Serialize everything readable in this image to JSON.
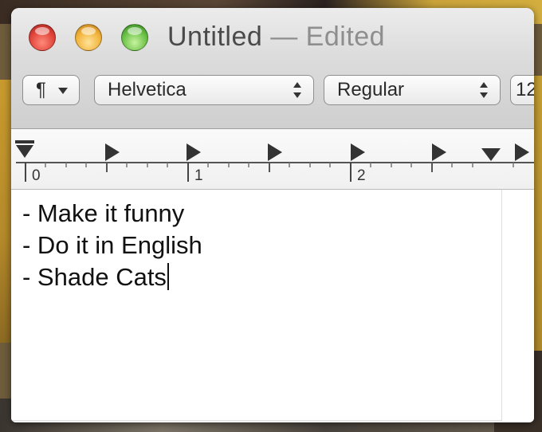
{
  "window": {
    "title": "Untitled",
    "edited_suffix": "— Edited"
  },
  "toolbar": {
    "paragraph_glyph": "¶",
    "font_family_value": "Helvetica",
    "font_style_value": "Regular",
    "font_size_value": "12"
  },
  "ruler": {
    "labels": [
      "0",
      "1",
      "2"
    ]
  },
  "document": {
    "lines": [
      "- Make it funny",
      "- Do it in English",
      "- Shade Cats"
    ]
  },
  "icons": {
    "close": "close-button-icon",
    "minimize": "minimize-button-icon",
    "zoom": "zoom-button-icon",
    "paragraph": "paragraph-icon",
    "stepper": "up-down-stepper-icon",
    "tab_stop": "tab-stop-icon",
    "indent": "indent-marker-icon"
  },
  "colors": {
    "close": "#e0443a",
    "minimize": "#f2b33a",
    "zoom": "#6ac146",
    "title_text": "#4a4a4a",
    "edited_text": "#8e8e8e"
  }
}
